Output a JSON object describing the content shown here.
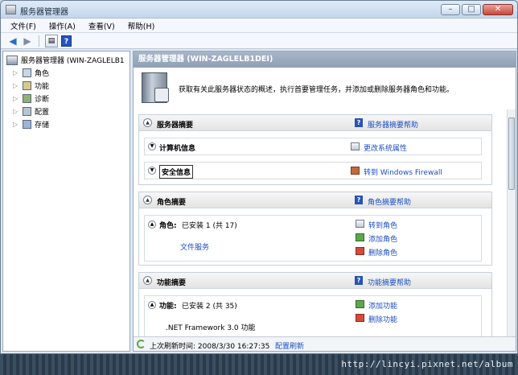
{
  "window": {
    "title": "服务器管理器"
  },
  "menu": [
    "文件(F)",
    "操作(A)",
    "查看(V)",
    "帮助(H)"
  ],
  "tree": {
    "root": "服务器管理器 (WIN-ZAGLELB1",
    "children": [
      "角色",
      "功能",
      "诊断",
      "配置",
      "存储"
    ]
  },
  "main": {
    "header": "服务器管理器 (WIN-ZAGLELB1DEI)",
    "intro": "获取有关此服务器状态的概述，执行首要管理任务，并添加或删除服务器角色和功能。",
    "server_summary": {
      "title": "服务器摘要",
      "help": "服务器摘要帮助",
      "computer_info": "计算机信息",
      "change_props": "更改系统属性",
      "security_info": "安全信息",
      "firewall": "转到 Windows Firewall"
    },
    "roles_summary": {
      "title": "角色摘要",
      "help": "角色摘要帮助",
      "label": "角色:",
      "installed": "已安装 1 (共 17)",
      "item": "文件服务",
      "goto": "转到角色",
      "add": "添加角色",
      "remove": "删除角色"
    },
    "features_summary": {
      "title": "功能摘要",
      "help": "功能摘要帮助",
      "label": "功能:",
      "installed": "已安装 2 (共 35)",
      "item": ".NET Framework 3.0 功能",
      "add": "添加功能",
      "remove": "删除功能"
    },
    "status": {
      "last_refresh": "上次刷新时间: 2008/3/30 16:27:35",
      "configure": "配置刷新"
    }
  },
  "watermark": "http://lincyi.pixnet.net/album"
}
